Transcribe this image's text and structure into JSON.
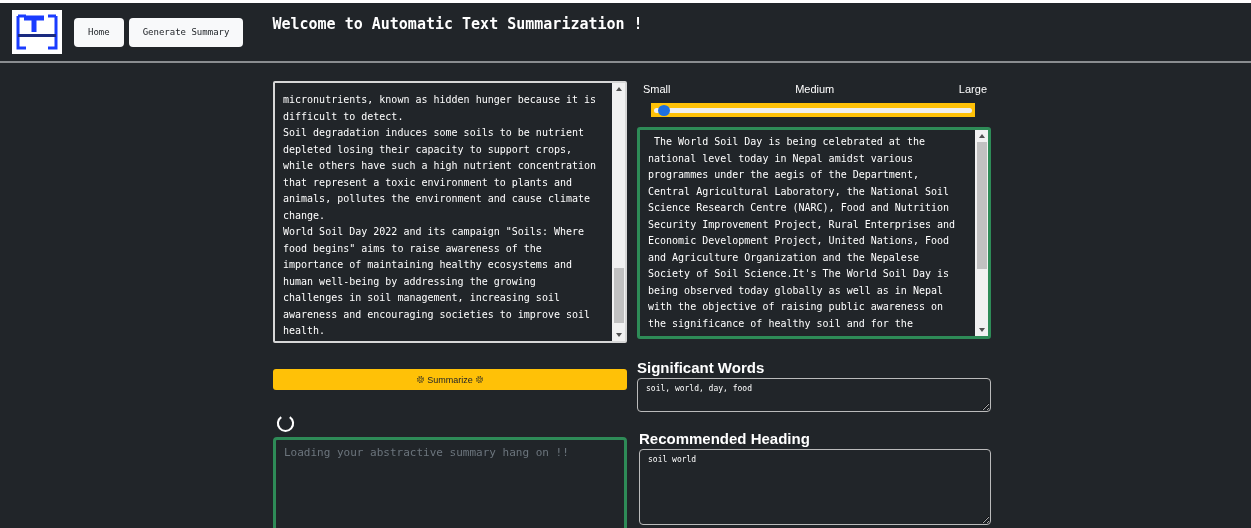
{
  "header": {
    "logo": {
      "kind": "logo"
    },
    "nav": [
      {
        "label": "Home"
      },
      {
        "label": "Generate Summary"
      }
    ],
    "title": "Welcome to Automatic Text Summarization !"
  },
  "input": {
    "text": "micronutrients, known as hidden hunger because it is\ndifficult to detect.\nSoil degradation induces some soils to be nutrient\ndepleted losing their capacity to support crops,\nwhile others have such a high nutrient concentration\nthat represent a toxic environment to plants and\nanimals, pollutes the environment and cause climate\nchange.\nWorld Soil Day 2022 and its campaign \"Soils: Where\nfood begins\" aims to raise awareness of the\nimportance of maintaining healthy ecosystems and\nhuman well-being by addressing the growing\nchallenges in soil management, increasing soil\nawareness and encouraging societies to improve soil\nhealth."
  },
  "length": {
    "labels": [
      "Small",
      "Medium",
      "Large"
    ],
    "level": 0.03
  },
  "extractive": {
    "text": " The World Soil Day is being celebrated at the\nnational level today in Nepal amidst various\nprogrammes under the aegis of the Department,\nCentral Agricultural Laboratory, the National Soil\nScience Research Centre (NARC), Food and Nutrition\nSecurity Improvement Project, Rural Enterprises and\nEconomic Development Project, United Nations, Food\nand Agriculture Organization and the Nepalese\nSociety of Soil Science.It's The World Soil Day is\nbeing observed today globally as well as in Nepal\nwith the objective of raising public awareness on\nthe significance of healthy soil and for the"
  },
  "summarize_button": {
    "label": "Summarize"
  },
  "significant_words": {
    "heading": "Significant Words",
    "value": "soil, world, day, food"
  },
  "loading": true,
  "abstractive": {
    "placeholder": "Loading your abstractive summary hang on !!"
  },
  "recommended_heading": {
    "heading": "Recommended Heading",
    "value": "soil world"
  }
}
